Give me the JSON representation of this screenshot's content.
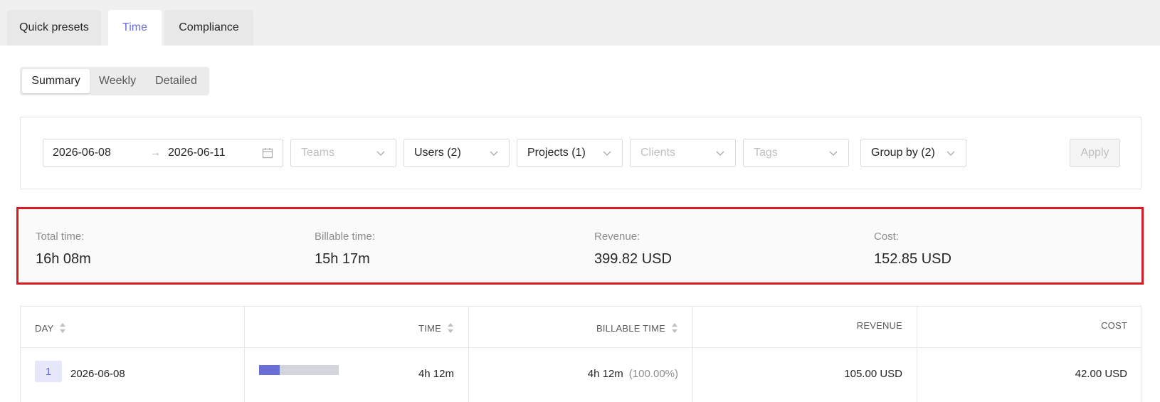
{
  "top_tabs": [
    {
      "label": "Quick presets",
      "active": false
    },
    {
      "label": "Time",
      "active": true
    },
    {
      "label": "Compliance",
      "active": false
    }
  ],
  "report_modes": [
    {
      "label": "Summary",
      "active": true
    },
    {
      "label": "Weekly",
      "active": false
    },
    {
      "label": "Detailed",
      "active": false
    }
  ],
  "filters": {
    "date_start": "2026-06-08",
    "date_separator": "→",
    "date_end": "2026-06-11",
    "teams_placeholder": "Teams",
    "users": "Users (2)",
    "projects": "Projects (1)",
    "clients_placeholder": "Clients",
    "tags_placeholder": "Tags",
    "group_by": "Group by (2)",
    "apply_label": "Apply"
  },
  "totals": {
    "total_time_label": "Total time:",
    "total_time_value": "16h 08m",
    "billable_time_label": "Billable time:",
    "billable_time_value": "15h 17m",
    "revenue_label": "Revenue:",
    "revenue_value": "399.82 USD",
    "cost_label": "Cost:",
    "cost_value": "152.85 USD"
  },
  "table": {
    "headers": {
      "day": "DAY",
      "time": "TIME",
      "billable_time": "BILLABLE TIME",
      "revenue": "REVENUE",
      "cost": "COST"
    },
    "rows": [
      {
        "index": "1",
        "day": "2026-06-08",
        "time": "4h 12m",
        "time_share": 0.26,
        "billable_time": "4h 12m",
        "billable_pct": "(100.00%)",
        "revenue": "105.00 USD",
        "cost": "42.00 USD"
      }
    ]
  },
  "colors": {
    "accent": "#6a6fd6",
    "highlight_border": "#d81b22"
  }
}
